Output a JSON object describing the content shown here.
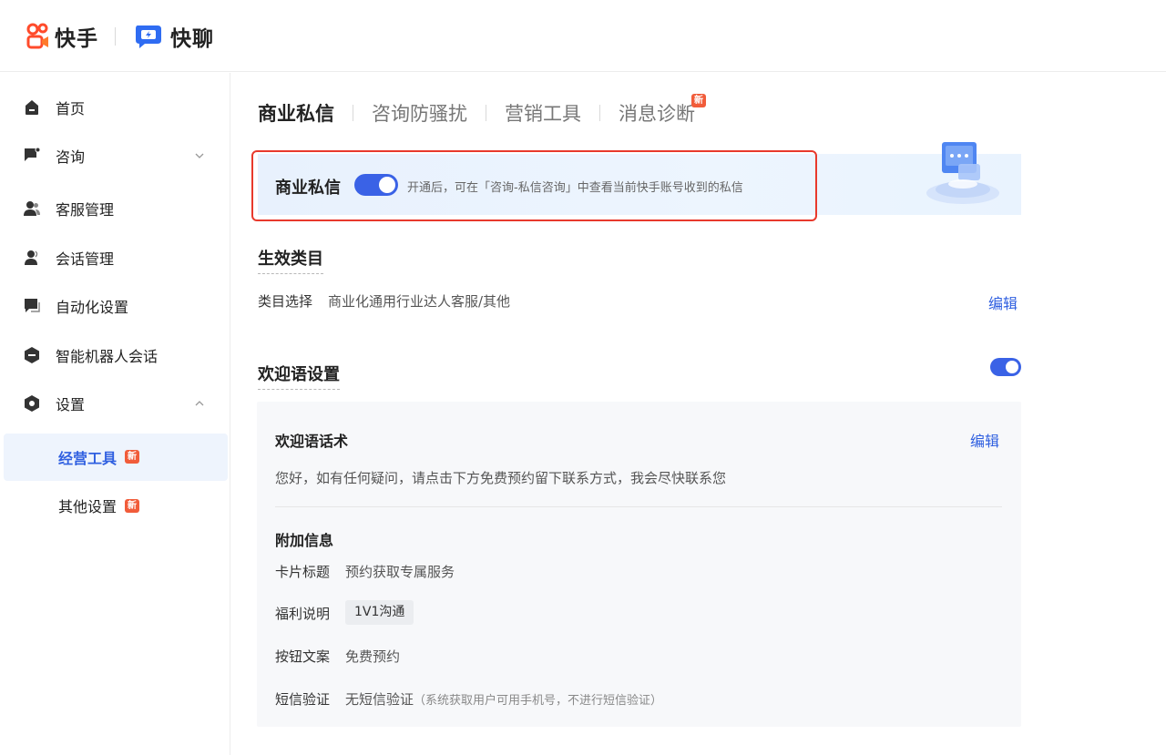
{
  "header": {
    "brand_primary": "快手",
    "brand_secondary": "快聊"
  },
  "sidebar": {
    "items": [
      {
        "label": "首页",
        "icon": "home-icon"
      },
      {
        "label": "咨询",
        "icon": "chat-flag-icon"
      },
      {
        "label": "客服管理",
        "icon": "users-icon"
      },
      {
        "label": "会话管理",
        "icon": "headset-user-icon"
      },
      {
        "label": "自动化设置",
        "icon": "message-icon"
      },
      {
        "label": "智能机器人会话",
        "icon": "robot-icon"
      },
      {
        "label": "设置",
        "icon": "settings-hexagon-icon"
      }
    ],
    "subitems": [
      {
        "label": "经营工具",
        "badge": "新",
        "active": true
      },
      {
        "label": "其他设置",
        "badge": "新",
        "active": false
      }
    ]
  },
  "tabs": [
    {
      "label": "商业私信",
      "active": true
    },
    {
      "label": "咨询防骚扰",
      "active": false
    },
    {
      "label": "营销工具",
      "active": false
    },
    {
      "label": "消息诊断",
      "active": false,
      "badge": "新"
    }
  ],
  "banner": {
    "title": "商业私信",
    "enabled": true,
    "description": "开通后，可在「咨询-私信咨询」中查看当前快手账号收到的私信"
  },
  "category": {
    "title": "生效类目",
    "label": "类目选择",
    "value": "商业化通用行业达人客服/其他",
    "edit": "编辑"
  },
  "welcome": {
    "title": "欢迎语设置",
    "enabled": true,
    "script_title": "欢迎语话术",
    "edit": "编辑",
    "script_text": "您好，如有任何疑问，请点击下方免费预约留下联系方式，我会尽快联系您",
    "extra_title": "附加信息",
    "fields": {
      "card_title_label": "卡片标题",
      "card_title_value": "预约获取专属服务",
      "benefit_label": "福利说明",
      "benefit_value": "1V1沟通",
      "button_label": "按钮文案",
      "button_value": "免费预约",
      "sms_label": "短信验证",
      "sms_value": "无短信验证",
      "sms_note": "（系统获取用户可用手机号，不进行短信验证）"
    }
  },
  "colors": {
    "accent": "#3a62e6",
    "link": "#2f5fe0",
    "badge": "#f15c3a",
    "highlight_border": "#e8392c"
  }
}
